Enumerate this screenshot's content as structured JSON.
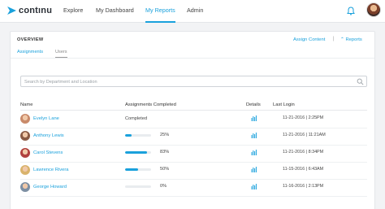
{
  "app": {
    "logo_text": "contınu",
    "brand_color": "#1aa1dc",
    "nav": [
      {
        "label": "Explore",
        "active": false
      },
      {
        "label": "My Dashboard",
        "active": false
      },
      {
        "label": "My Reports",
        "active": true
      },
      {
        "label": "Admin",
        "active": false
      }
    ]
  },
  "card": {
    "title": "OVERVIEW",
    "assign_content": "Assign Content",
    "separator": "|",
    "reports_link": "⌃ Reports",
    "tabs": [
      {
        "label": "Assignments",
        "active": true
      },
      {
        "label": "Users",
        "active": false
      }
    ],
    "search": {
      "placeholder": "Search by Department and Location",
      "value": ""
    }
  },
  "table": {
    "columns": [
      "Name",
      "Assignments Completed",
      "Details",
      "Last Login"
    ],
    "rows": [
      {
        "name": "Evelyn Lane",
        "status": "Completed",
        "percent_text": "",
        "progress": 1.0,
        "show_bar": false,
        "last_login": "11-21-2016 | 2:25PM",
        "avatar_color": "#c98a6a"
      },
      {
        "name": "Anthony Lewis",
        "status": "",
        "percent_text": "25%",
        "progress": 0.25,
        "show_bar": true,
        "last_login": "11-21-2016 | 11:21AM",
        "avatar_color": "#8a5a44"
      },
      {
        "name": "Carol Stevens",
        "status": "",
        "percent_text": "83%",
        "progress": 0.83,
        "show_bar": true,
        "last_login": "11-21-2016 | 8:34PM",
        "avatar_color": "#b0413e"
      },
      {
        "name": "Lawrence Rivera",
        "status": "",
        "percent_text": "50%",
        "progress": 0.5,
        "show_bar": true,
        "last_login": "11-15-2016 | 6:43AM",
        "avatar_color": "#d9b36c"
      },
      {
        "name": "George Howard",
        "status": "",
        "percent_text": "0%",
        "progress": 0.0,
        "show_bar": true,
        "last_login": "11-16-2016 | 2:13PM",
        "avatar_color": "#7d8fa3"
      }
    ]
  }
}
